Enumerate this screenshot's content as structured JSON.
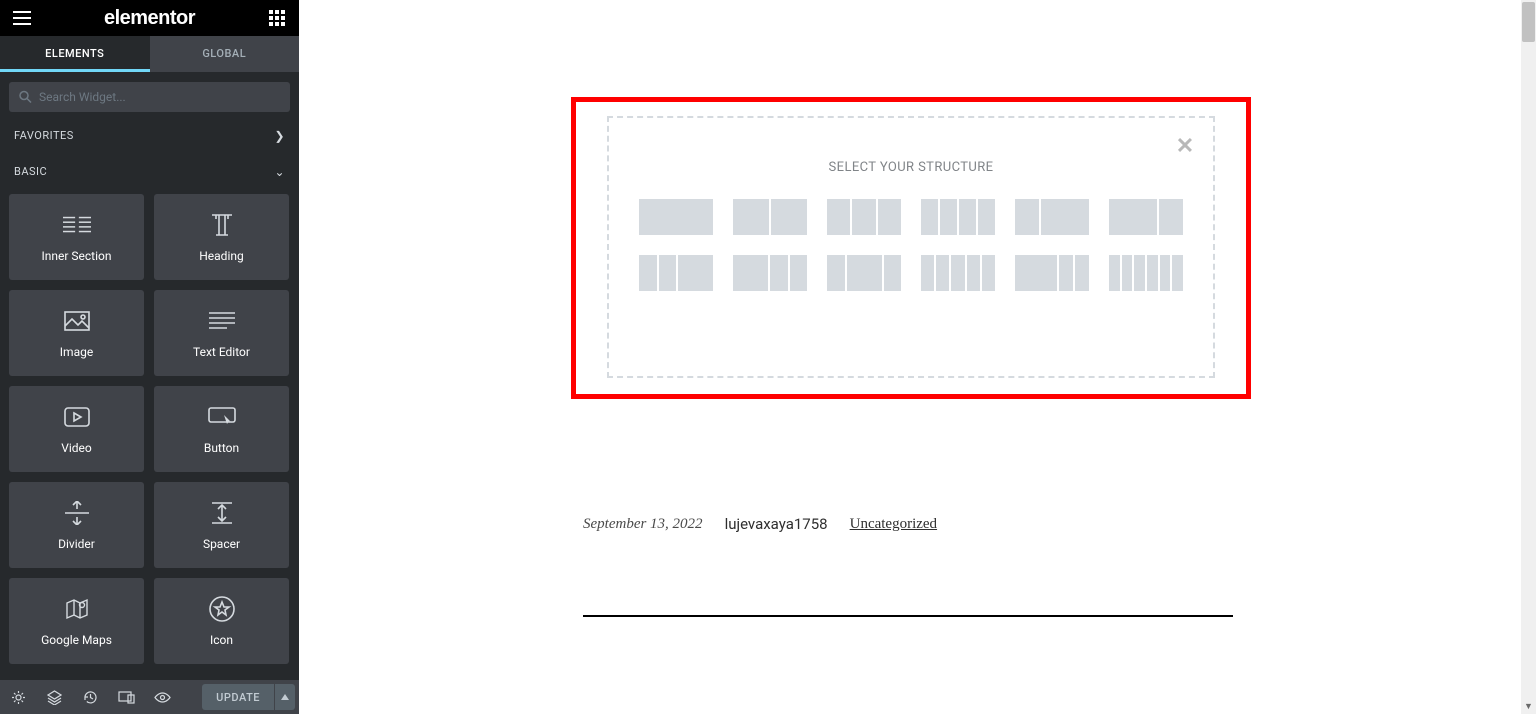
{
  "header": {
    "logo": "elementor"
  },
  "tabs": {
    "elements": "ELEMENTS",
    "global": "GLOBAL"
  },
  "search": {
    "placeholder": "Search Widget..."
  },
  "sections": {
    "favorites": "FAVORITES",
    "basic": "BASIC"
  },
  "widgets": {
    "inner_section": "Inner Section",
    "heading": "Heading",
    "image": "Image",
    "text_editor": "Text Editor",
    "video": "Video",
    "button": "Button",
    "divider": "Divider",
    "spacer": "Spacer",
    "google_maps": "Google Maps",
    "icon": "Icon"
  },
  "footer": {
    "update": "UPDATE"
  },
  "dropzone": {
    "title": "SELECT YOUR STRUCTURE"
  },
  "meta": {
    "date": "September 13, 2022",
    "author": "lujevaxaya1758",
    "category": "Uncategorized"
  }
}
